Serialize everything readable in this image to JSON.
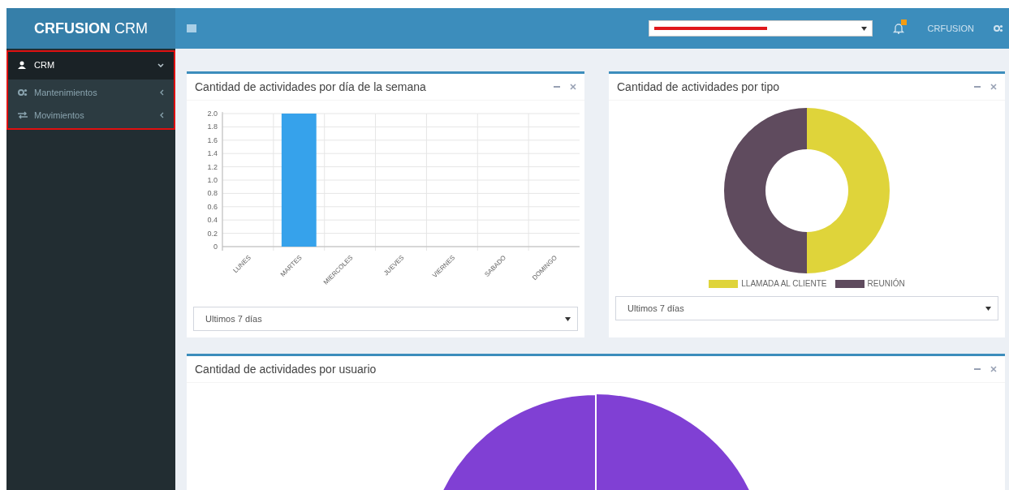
{
  "header": {
    "brand_bold": "CRFUSION",
    "brand_light": "CRM",
    "company_select": {
      "redacted": true
    },
    "notifications": {
      "has_new": true
    },
    "user": "CRFUSION"
  },
  "sidebar": {
    "highlighted": true,
    "items": [
      {
        "label": "CRM",
        "expanded": true,
        "children": [
          {
            "label": "Mantenimientos",
            "kind": "gears",
            "expanded": false
          },
          {
            "label": "Movimientos",
            "kind": "arrows",
            "expanded": false
          }
        ]
      }
    ]
  },
  "widgets": [
    {
      "title": "Cantidad de actividades por día de la semana",
      "kind": "bar",
      "filter": "Ultimos 7 días",
      "chart_data": {
        "type": "bar",
        "categories": [
          "LUNES",
          "MARTES",
          "MIERCOLES",
          "JUEVES",
          "VIERNES",
          "SABADO",
          "DOMINGO"
        ],
        "values": [
          0,
          2,
          0,
          0,
          0,
          0,
          0
        ],
        "grid": true,
        "ylim": [
          0,
          2
        ],
        "yticks": [
          0,
          0.2,
          0.4,
          0.6,
          0.8,
          {
            "value": 1,
            "label": "1.0"
          },
          1.2,
          1.4,
          1.6,
          1.8,
          {
            "value": 2,
            "label": "2.0"
          }
        ]
      }
    },
    {
      "title": "Cantidad de actividades por tipo",
      "kind": "donut",
      "filter": "Ultimos 7 días",
      "legend": [
        {
          "label": "LLAMADA AL CLIENTE",
          "color": "#dfd43a"
        },
        {
          "label": "REUNIÓN",
          "color": "#5f4b5e"
        }
      ]
    },
    {
      "title": "Cantidad de actividades por usuario",
      "kind": "pie"
    }
  ]
}
